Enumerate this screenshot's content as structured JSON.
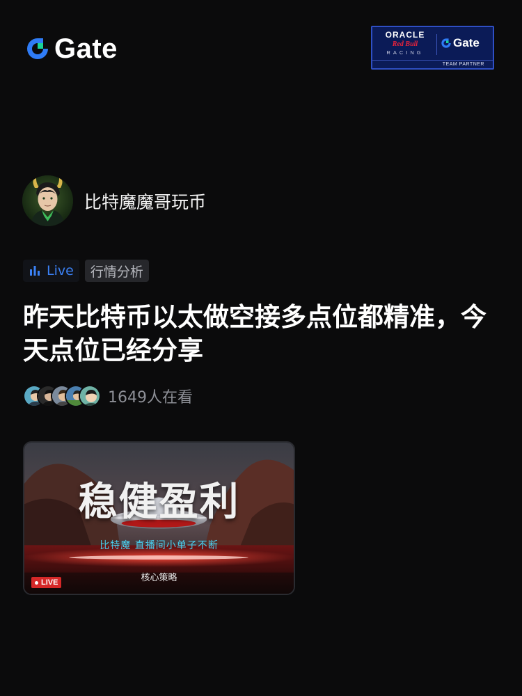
{
  "header": {
    "brand_name": "Gate",
    "brand_accent": "#2f7cf6",
    "partner": {
      "line1": "ORACLE",
      "line2": "Red Bull",
      "line3": "RACING",
      "gate_name": "Gate",
      "footer": "TEAM PARTNER"
    }
  },
  "author": {
    "name": "比特魔魔哥玩币",
    "avatar_icon": "devil-avatar"
  },
  "tags": {
    "live_label": "Live",
    "category_label": "行情分析"
  },
  "post": {
    "headline": "昨天比特币以太做空接多点位都精准，今天点位已经分享",
    "viewers_text": "1649人在看"
  },
  "live_card": {
    "title": "稳健盈利",
    "subtitle": "比特魔  直播间小单子不断",
    "footer_text": "核心策略",
    "badge": "LIVE"
  }
}
